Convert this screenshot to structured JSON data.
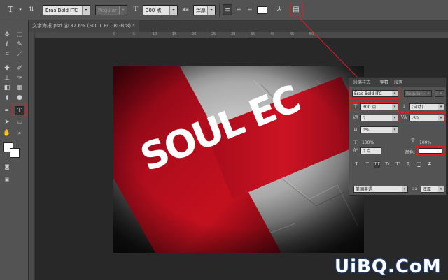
{
  "options_bar": {
    "font_family": "Eras Bold ITC",
    "font_style": "Regular",
    "font_size": "300 点",
    "aa_label": "aa",
    "anti_alias": "浑厚",
    "text_color": "#ffffff"
  },
  "document_tab": {
    "title": "文字海报.psd @ 37.6% (SOUL EC, RGB/8) *"
  },
  "ruler": {
    "top_ticks": [
      "0",
      "5",
      "10",
      "15",
      "20",
      "25",
      "30",
      "35",
      "40",
      "45",
      "50"
    ]
  },
  "canvas": {
    "headline": "SOUL EC",
    "accent_color": "#c4101e"
  },
  "character_panel": {
    "tabs": [
      "段落样式",
      "字符",
      "段落"
    ],
    "font_family": "Eras Bold ITC",
    "font_style": "Regular",
    "font_size": "300 点",
    "leading": "(自动)",
    "kerning": "0",
    "tracking": "-50",
    "scale_percent": "0%",
    "vertical_scale": "100%",
    "horizontal_scale": "100%",
    "baseline_shift": "0 点",
    "color_label": "颜色:",
    "color_value": "#ffffff",
    "language": "美国英语",
    "aa_label": "aa",
    "anti_alias": "浑厚",
    "style_buttons": [
      "T",
      "T",
      "TT",
      "Tr",
      "T'",
      "T,",
      "T",
      "T"
    ]
  },
  "watermark": {
    "text": "UiBQ.CoM"
  }
}
